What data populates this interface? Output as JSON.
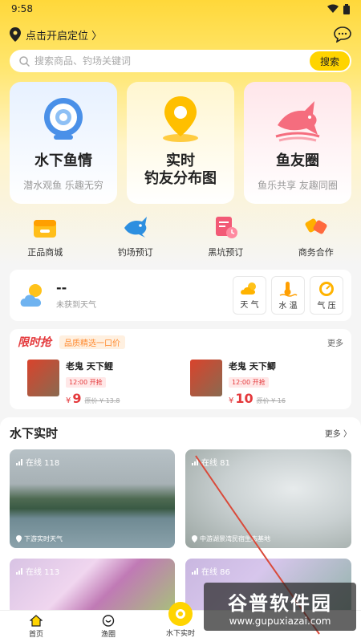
{
  "status_bar": {
    "time": "9:58"
  },
  "location": {
    "label": "点击开启定位 〉"
  },
  "search": {
    "placeholder": "搜索商品、钓场关键词",
    "button": "搜索"
  },
  "feature_cards": [
    {
      "title": "水下鱼情",
      "subtitle": "潜水观鱼 乐趣无穷",
      "icon": "camera-icon"
    },
    {
      "title": "实时\n钓友分布图",
      "subtitle": "",
      "icon": "map-pin-icon"
    },
    {
      "title": "鱼友圈",
      "subtitle": "鱼乐共享 友趣同圈",
      "icon": "fish-icon"
    }
  ],
  "quick_links": [
    {
      "label": "正品商城",
      "icon": "shop-icon"
    },
    {
      "label": "钓场预订",
      "icon": "fish-book-icon"
    },
    {
      "label": "黑坑预订",
      "icon": "calendar-icon"
    },
    {
      "label": "商务合作",
      "icon": "handshake-icon"
    }
  ],
  "weather": {
    "value": "--",
    "status": "未获到天气",
    "buttons": [
      {
        "label": "天 气",
        "icon": "cloud-sun-icon"
      },
      {
        "label": "水 温",
        "icon": "thermometer-icon"
      },
      {
        "label": "气 压",
        "icon": "gauge-icon"
      }
    ]
  },
  "flash_sale": {
    "title": "限时抢",
    "subtitle": "品质精选一口价",
    "more": "更多",
    "items": [
      {
        "name": "老鬼 天下鲤",
        "time": "12:00 开抢",
        "currency": "¥",
        "price": "9",
        "original": "原价 ¥ 13.8"
      },
      {
        "name": "老鬼 天下鲫",
        "time": "12:00 开抢",
        "currency": "¥",
        "price": "10",
        "original": "原价 ¥ 16"
      }
    ]
  },
  "live": {
    "title": "水下实时",
    "more": "更多 〉",
    "streams": [
      {
        "online": "在线 118",
        "location": "下游实时天气"
      },
      {
        "online": "在线 81",
        "location": "中游湖景湾民宿生态基地"
      },
      {
        "online": "在线 113",
        "location": ""
      },
      {
        "online": "在线 86",
        "location": ""
      }
    ]
  },
  "tabs": [
    {
      "label": "首页",
      "icon": "home-icon"
    },
    {
      "label": "渔圈",
      "icon": "circle-icon"
    },
    {
      "label": "水下实时",
      "icon": "live-icon"
    },
    {
      "label": "",
      "icon": ""
    },
    {
      "label": "",
      "icon": ""
    }
  ],
  "watermark": {
    "title": "谷普软件园",
    "url": "www.gupuxiazai.com"
  },
  "colors": {
    "brand_yellow": "#ffd400",
    "price_red": "#e4393c"
  }
}
